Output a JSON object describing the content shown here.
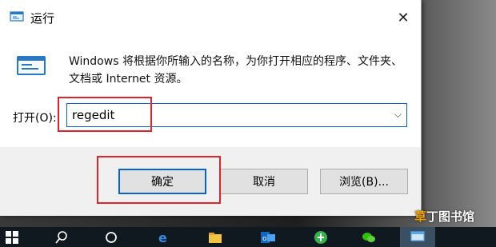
{
  "window": {
    "title": "运行",
    "close_symbol": "✕"
  },
  "description": "Windows 将根据你所输入的名称，为你打开相应的程序、文件夹、文档或 Internet 资源。",
  "open_field": {
    "label": "打开(O):",
    "value": "regedit",
    "dropdown_symbol": "⌵"
  },
  "buttons": {
    "ok": "确定",
    "cancel": "取消",
    "browse": "浏览(B)..."
  },
  "watermark": {
    "grass": "草",
    "rest": "丁图书馆"
  },
  "taskbar": {
    "icons": [
      "windows-start-icon",
      "search-icon",
      "task-view-icon",
      "edge-icon",
      "file-explorer-icon",
      "outlook-icon",
      "green-app-icon",
      "wechat-icon",
      "run-icon"
    ]
  },
  "colors": {
    "highlight_red": "#e0242b",
    "focus_blue": "#0a64c8"
  }
}
